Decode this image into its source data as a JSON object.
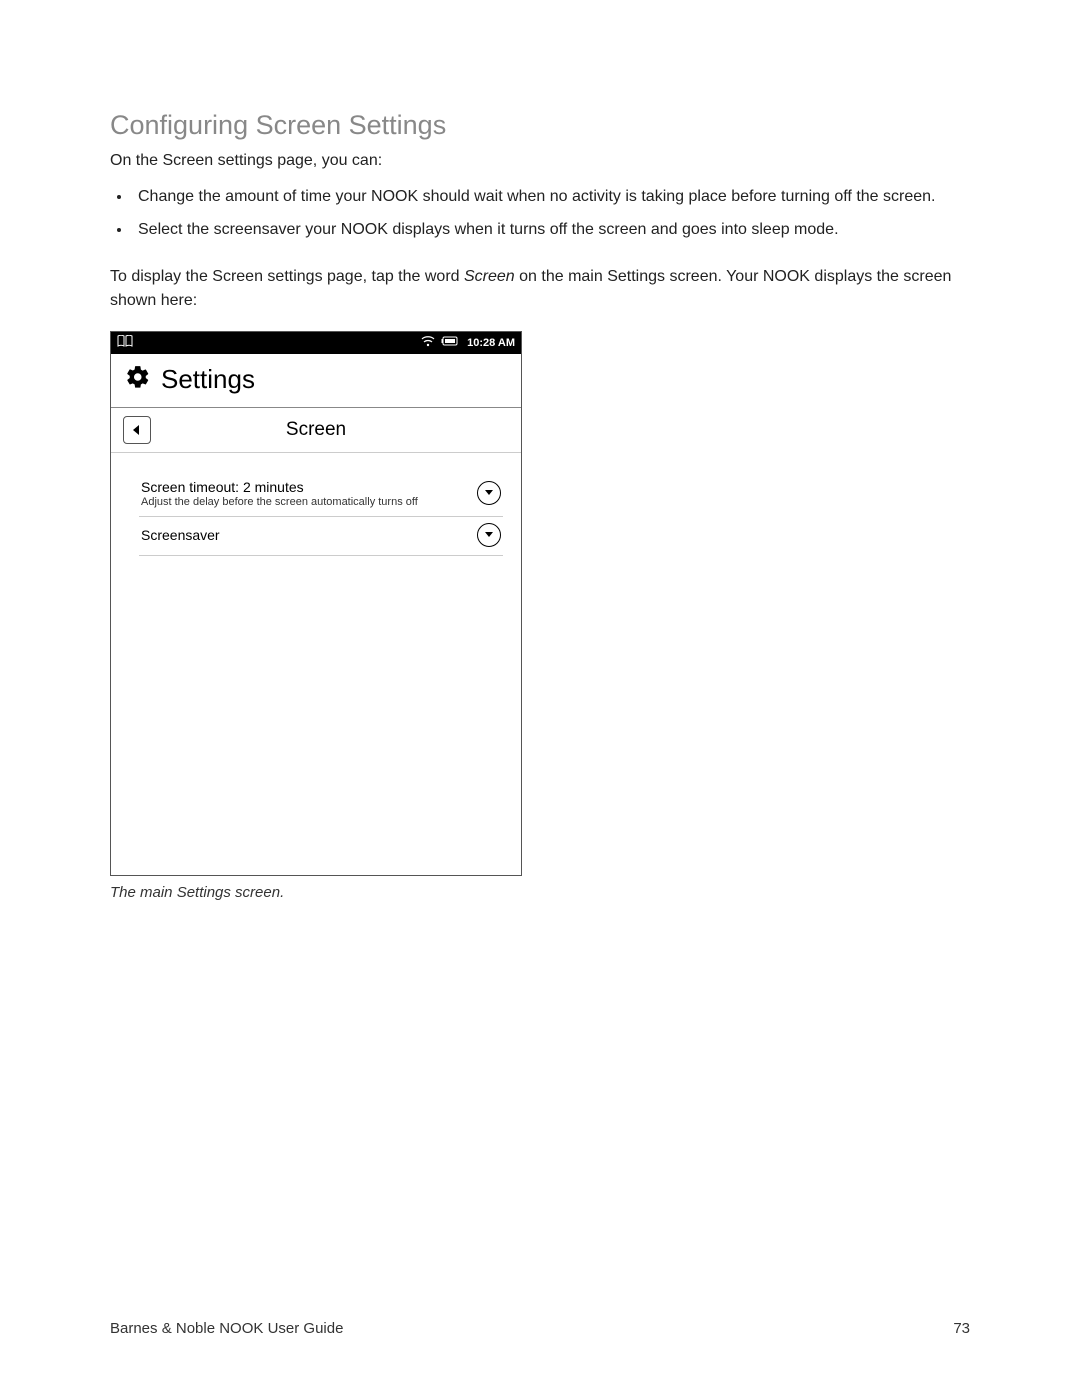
{
  "heading": "Configuring Screen Settings",
  "intro": "On the Screen settings page, you can:",
  "bullets": [
    "Change the amount of time your NOOK should wait when no activity is taking place before turning off the screen.",
    "Select the screensaver your NOOK displays when it turns off the screen and goes into sleep mode."
  ],
  "instruction_pre": "To display the Screen settings page, tap the word ",
  "instruction_em": "Screen",
  "instruction_post": " on the main Settings screen. Your NOOK displays the screen shown here:",
  "caption": "The main Settings screen.",
  "device": {
    "clock": "10:28 AM",
    "settings_title": "Settings",
    "screen_title": "Screen",
    "items": [
      {
        "primary": "Screen timeout: 2 minutes",
        "secondary": "Adjust the delay before the screen automatically turns off"
      },
      {
        "primary": "Screensaver",
        "secondary": ""
      }
    ]
  },
  "footer_left": "Barnes & Noble NOOK User Guide",
  "footer_right": "73"
}
